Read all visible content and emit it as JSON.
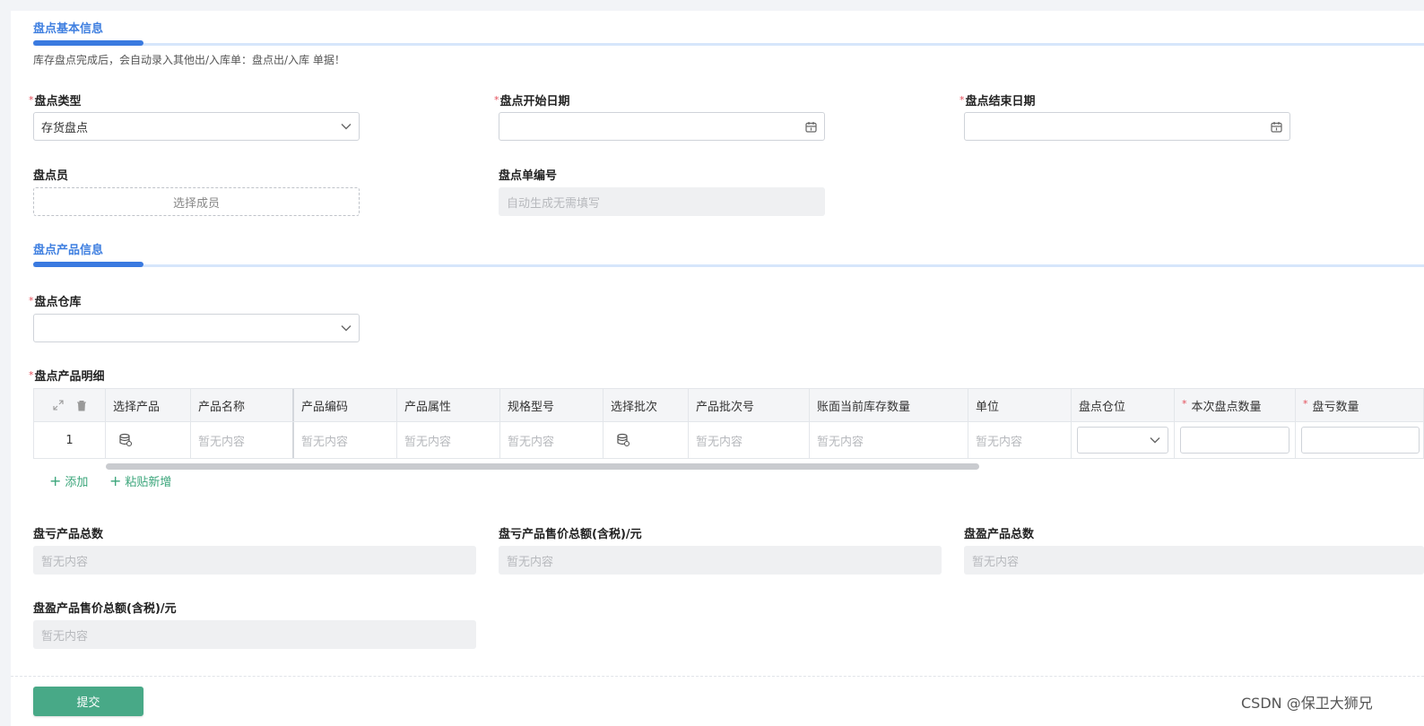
{
  "basic_section": {
    "title": "盘点基本信息",
    "hint": "库存盘点完成后，会自动录入其他出/入库单：盘点出/入库 单据！"
  },
  "fields": {
    "type": {
      "label": "盘点类型",
      "required": "*",
      "value": "存货盘点"
    },
    "start_date": {
      "label": "盘点开始日期",
      "required": "*",
      "value": ""
    },
    "end_date": {
      "label": "盘点结束日期",
      "required": "*",
      "value": ""
    },
    "counter": {
      "label": "盘点员",
      "placeholder": "选择成员"
    },
    "order_no": {
      "label": "盘点单编号",
      "placeholder": "自动生成无需填写"
    }
  },
  "product_section": {
    "title": "盘点产品信息",
    "warehouse": {
      "label": "盘点仓库",
      "required": "*",
      "value": ""
    },
    "detail_label": "盘点产品明细",
    "detail_required": "*"
  },
  "table": {
    "headers": {
      "select_product": "选择产品",
      "product_name": "产品名称",
      "product_code": "产品编码",
      "product_attr": "产品属性",
      "spec_model": "规格型号",
      "select_batch": "选择批次",
      "batch_no": "产品批次号",
      "book_stock": "账面当前库存数量",
      "unit": "单位",
      "location": "盘点仓位",
      "count_qty": "本次盘点数量",
      "loss_qty": "盘亏数量"
    },
    "header_required": "*",
    "row": {
      "index": "1",
      "empty": "暂无内容"
    }
  },
  "actions": {
    "add": "添加",
    "paste_add": "粘贴新增",
    "submit": "提交"
  },
  "totals": {
    "loss_count": {
      "label": "盘亏产品总数",
      "placeholder": "暂无内容"
    },
    "loss_amount": {
      "label": "盘亏产品售价总额(含税)/元",
      "placeholder": "暂无内容"
    },
    "gain_count": {
      "label": "盘盈产品总数",
      "placeholder": "暂无内容"
    },
    "gain_amount": {
      "label": "盘盈产品售价总额(含税)/元",
      "placeholder": "暂无内容"
    }
  },
  "watermark": "CSDN @保卫大狮兄",
  "colors": {
    "accent": "#3a7ae0",
    "submit": "#48a987",
    "required": "#e34d59",
    "link": "#3aa57a"
  }
}
